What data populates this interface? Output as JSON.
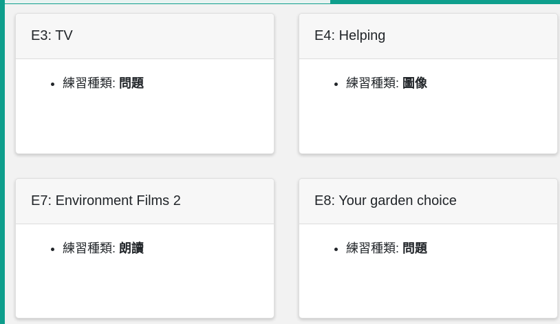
{
  "cards": [
    {
      "title": "E3: TV",
      "type_label": "練習種類:",
      "type_value": "問題"
    },
    {
      "title": "E4: Helping",
      "type_label": "練習種類:",
      "type_value": "圖像"
    },
    {
      "title": "E7: Environment Films 2",
      "type_label": "練習種類:",
      "type_value": "朗讀"
    },
    {
      "title": "E8: Your garden choice",
      "type_label": "練習種類:",
      "type_value": "問題"
    }
  ],
  "colors": {
    "frame_accent": "#0e9e8c",
    "card_header_bg": "#f7f7f7",
    "card_bg": "#ffffff"
  }
}
